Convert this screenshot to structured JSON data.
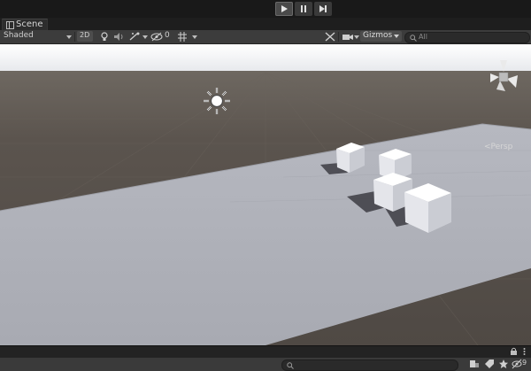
{
  "toolbar": {
    "play_icon": "play-icon",
    "pause_icon": "pause-icon",
    "step_icon": "step-icon"
  },
  "tabs": [
    {
      "label": "Scene",
      "icon": "scene-grid-icon"
    }
  ],
  "scene_toolbar": {
    "shading_mode": "Shaded",
    "mode_2d": "2D",
    "hidden_count": "0",
    "gizmos_label": "Gizmos",
    "search_placeholder": "All",
    "search_icon": "search-icon"
  },
  "viewport": {
    "projection_label": "<Persp",
    "sky_color": "#f2f3f6",
    "ground_color": "#57504a",
    "plane_color": "#aeb0b8",
    "cube_color": "#f4f5f8"
  },
  "bottom_bar": {
    "hidden_count": "9"
  }
}
